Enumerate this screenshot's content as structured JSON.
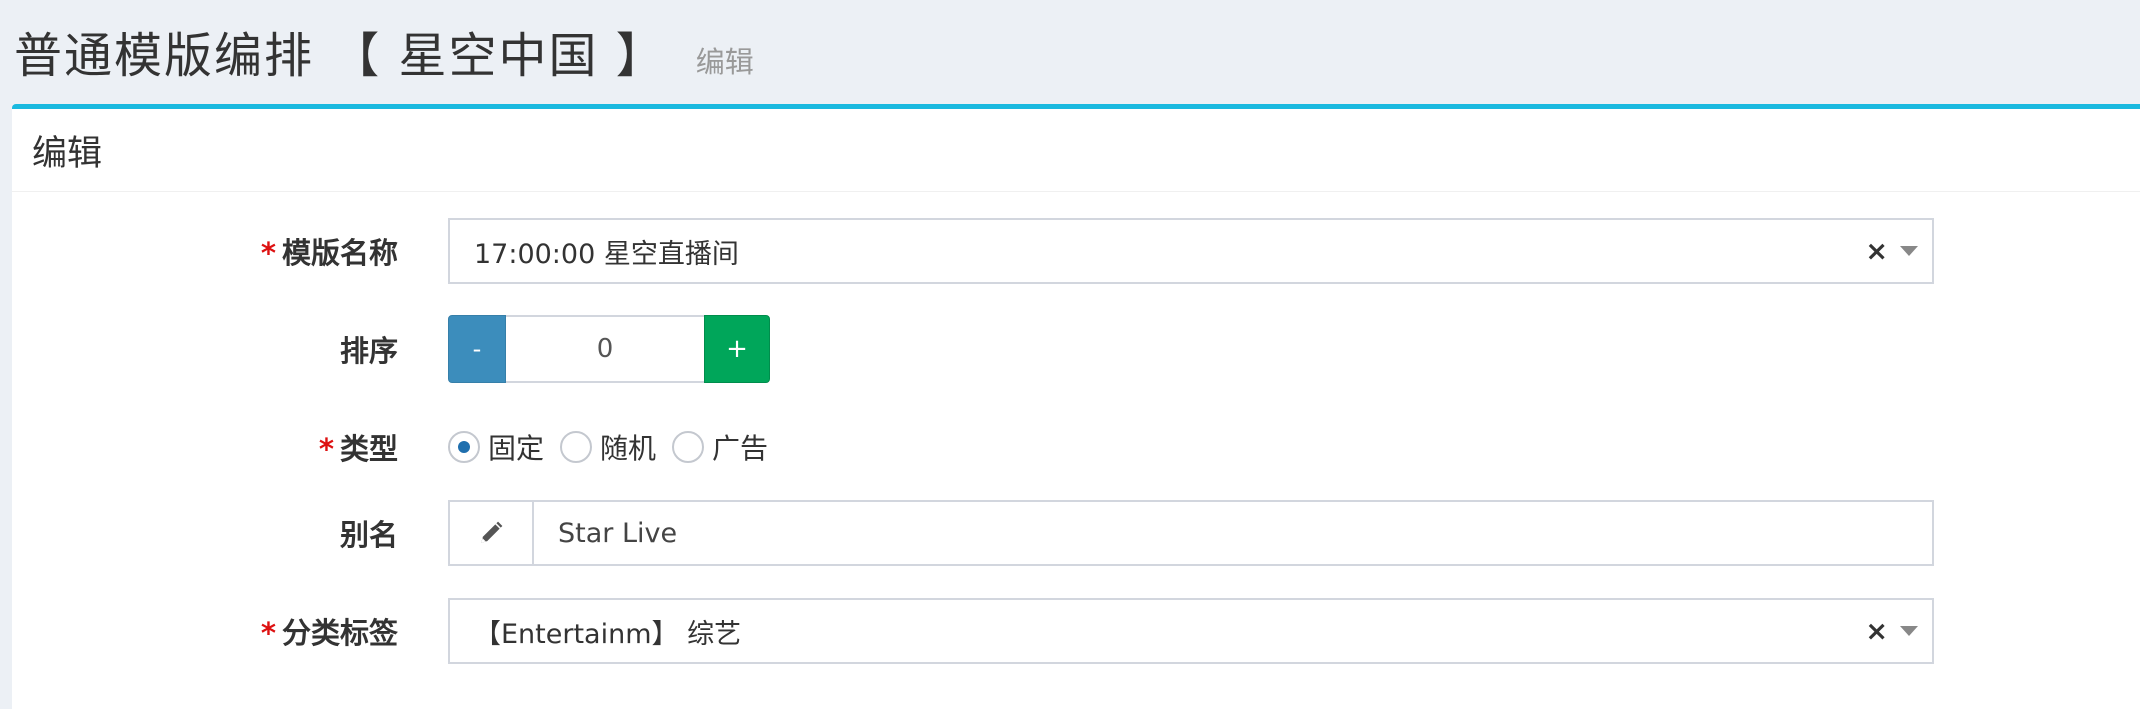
{
  "header": {
    "title": "普通模版编排 【 星空中国 】",
    "subtitle": "编辑"
  },
  "box": {
    "title": "编辑"
  },
  "form": {
    "template_name": {
      "label": "模版名称",
      "required": "*",
      "value": "17:00:00 星空直播间",
      "clear": "×"
    },
    "order": {
      "label": "排序",
      "minus": "-",
      "value": "0",
      "plus": "+"
    },
    "type": {
      "label": "类型",
      "required": "*",
      "options": [
        "固定",
        "随机",
        "广告"
      ],
      "selected": "固定"
    },
    "alias": {
      "label": "别名",
      "value": "Star Live",
      "icon": "pencil-icon"
    },
    "category_tag": {
      "label": "分类标签",
      "required": "*",
      "value": "【Entertainm】 综艺",
      "clear": "×"
    }
  },
  "colors": {
    "accent": "#1ab9df",
    "minus_button": "#3c8dbc",
    "plus_button": "#00a65a",
    "required": "#dd1111",
    "radio_selected": "#1f6fae"
  }
}
